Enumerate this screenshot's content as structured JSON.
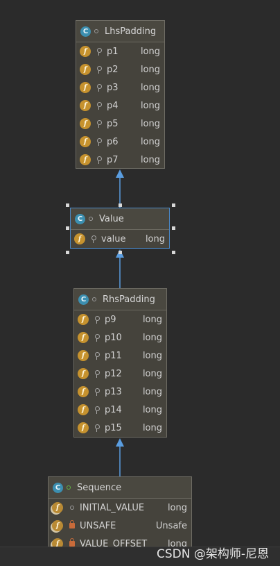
{
  "classes": {
    "lhs": {
      "name": "LhsPadding",
      "fields": [
        {
          "name": "p1",
          "type": "long"
        },
        {
          "name": "p2",
          "type": "long"
        },
        {
          "name": "p3",
          "type": "long"
        },
        {
          "name": "p4",
          "type": "long"
        },
        {
          "name": "p5",
          "type": "long"
        },
        {
          "name": "p6",
          "type": "long"
        },
        {
          "name": "p7",
          "type": "long"
        }
      ]
    },
    "value": {
      "name": "Value",
      "fields": [
        {
          "name": "value",
          "type": "long"
        }
      ]
    },
    "rhs": {
      "name": "RhsPadding",
      "fields": [
        {
          "name": "p9",
          "type": "long"
        },
        {
          "name": "p10",
          "type": "long"
        },
        {
          "name": "p11",
          "type": "long"
        },
        {
          "name": "p12",
          "type": "long"
        },
        {
          "name": "p13",
          "type": "long"
        },
        {
          "name": "p14",
          "type": "long"
        },
        {
          "name": "p15",
          "type": "long"
        }
      ]
    },
    "sequence": {
      "name": "Sequence",
      "fields": [
        {
          "name": "INITIAL_VALUE",
          "type": "long"
        },
        {
          "name": "UNSAFE",
          "type": "Unsafe"
        },
        {
          "name": "VALUE_OFFSET",
          "type": "long"
        }
      ]
    }
  },
  "icons": {
    "class_badge": "C",
    "field_badge": "f"
  },
  "colors": {
    "background": "#2b2b2b",
    "node": "#45433c",
    "arrow": "#5a9de0",
    "selection": "#4a88c7",
    "field_badge": "#c6922e",
    "class_badge": "#3c8fb0"
  },
  "watermark": "CSDN @架构师-尼恩"
}
